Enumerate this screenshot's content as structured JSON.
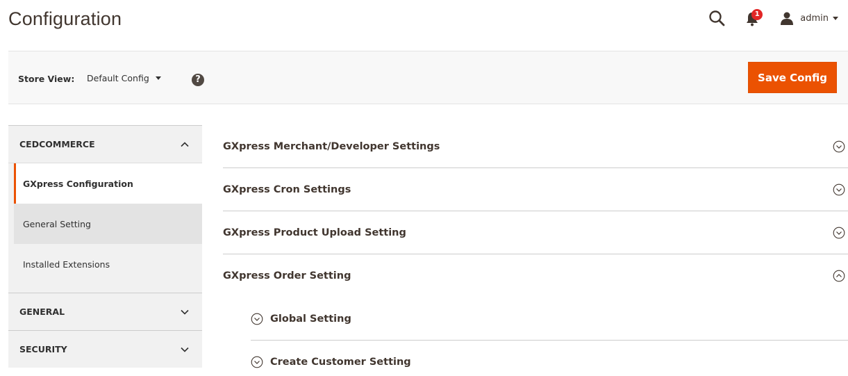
{
  "header": {
    "title": "Configuration",
    "notification_count": "1",
    "user_name": "admin"
  },
  "store_bar": {
    "label": "Store View:",
    "selected_scope": "Default Config",
    "help_symbol": "?",
    "save_label": "Save Config"
  },
  "sidebar": {
    "sections": [
      {
        "title": "CEDCOMMERCE",
        "expanded": true,
        "items": [
          {
            "label": "GXpress Configuration",
            "active": true
          },
          {
            "label": "General Setting",
            "active": false
          },
          {
            "label": "Installed Extensions",
            "active": false
          }
        ]
      },
      {
        "title": "GENERAL",
        "expanded": false
      },
      {
        "title": "SECURITY",
        "expanded": false
      }
    ]
  },
  "main": {
    "sections": [
      {
        "title": "GXpress Merchant/Developer Settings",
        "expanded": false
      },
      {
        "title": "GXpress Cron Settings",
        "expanded": false
      },
      {
        "title": "GXpress Product Upload Setting",
        "expanded": false
      },
      {
        "title": "GXpress Order Setting",
        "expanded": true
      }
    ],
    "subsections": [
      {
        "title": "Global Setting",
        "expanded": false
      },
      {
        "title": "Create Customer Setting",
        "expanded": false
      }
    ]
  },
  "colors": {
    "accent": "#eb5202",
    "badge": "#e22626",
    "sidebar_bg": "#f1f1f1"
  },
  "icons": [
    "search-icon",
    "bell-icon",
    "user-icon",
    "help-icon",
    "chevron-up-icon",
    "chevron-down-icon",
    "circle-chevron-down-icon",
    "circle-chevron-up-icon"
  ]
}
